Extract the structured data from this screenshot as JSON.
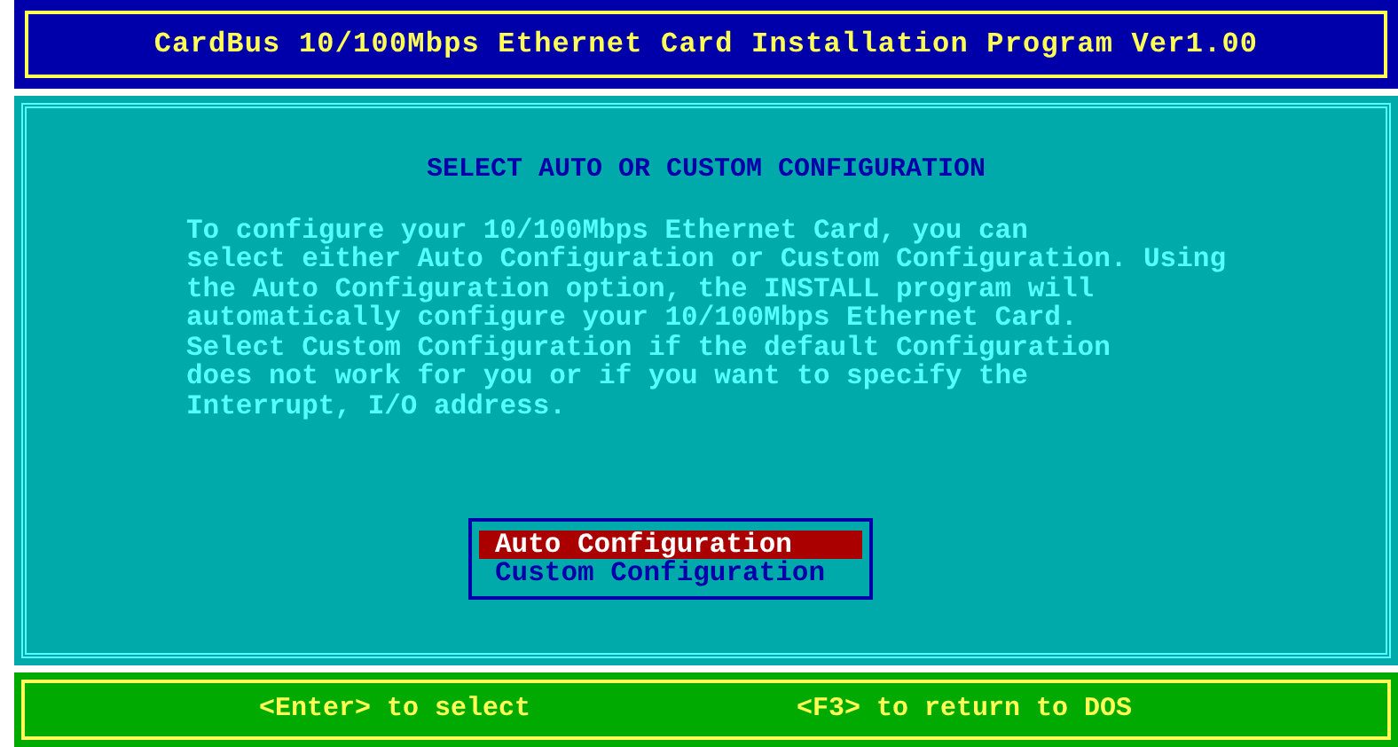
{
  "title_bar": {
    "title": "CardBus 10/100Mbps Ethernet Card Installation Program Ver1.00"
  },
  "panel": {
    "heading": "SELECT AUTO OR CUSTOM CONFIGURATION",
    "description": "To configure your 10/100Mbps Ethernet Card, you can\nselect either Auto Configuration or Custom Configuration. Using\nthe Auto Configuration option, the INSTALL program will\nautomatically configure your 10/100Mbps Ethernet Card.\nSelect Custom Configuration if the default Configuration\ndoes not work for you or if you want to specify the\nInterrupt, I/O address."
  },
  "menu": [
    {
      "label": "Auto Configuration",
      "selected": true
    },
    {
      "label": "Custom Configuration",
      "selected": false
    }
  ],
  "status_bar": {
    "hints": [
      "<Enter> to select",
      "<F3> to return to DOS"
    ]
  }
}
